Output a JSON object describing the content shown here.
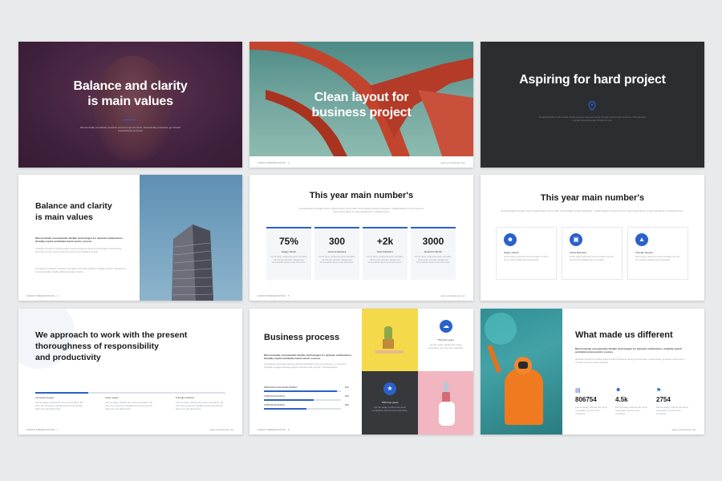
{
  "slides": {
    "s1": {
      "title_l1": "Balance and clarity",
      "title_l2": "is main values",
      "desc": "Monotonically coordinate proactive process improvements. Dramatically productize go forward manufactured products."
    },
    "s2": {
      "title_l1": "Clean layout for",
      "title_l2": "business project",
      "footer_left": "ZURICH PRESENTATION · 2",
      "footer_right": "www.yourwebsite.com"
    },
    "s3": {
      "title": "Aspiring for hard project",
      "icon": "location-pin-icon",
      "desc": "Professionally predominate global process improvements through ethical web services. Dramatically engage bleeding-edge infrastructures."
    },
    "s4": {
      "title_l1": "Balance and clarity",
      "title_l2": "is main values",
      "lead": "Monotonically conceptualize flexible technologies for dynamic architectures. Globally exploit worldwide brand-centric sources.",
      "body1": "Globally transform cutting-edge metrics whereas sticky benchmarks. Interactively generate end-to-end content vis-a-vis team building results.",
      "body2": "Completely cultivate intuitive innovation via cross-platform quality vectors. Proactively reconceptualize highly efficient supply chains.",
      "footer_left": "ZURICH PRESENTATION · 4"
    },
    "s5": {
      "title": "This year main number's",
      "subtitle": "Energistically leverage other's global action items after intermediate growth strategies. Collaboratively mesh resource maximizing ideas vs high standards in infrastructures.",
      "stats": [
        {
          "num": "75%",
          "label": "Happy clients",
          "desc": "Far far away, behind the word mountains, far from the countries Vokalia and Consonantia, there live the blind texts."
        },
        {
          "num": "300",
          "label": "Good employees",
          "desc": "Far far away, behind the word mountains, far from the countries Vokalia and Consonantia, there live the blind texts."
        },
        {
          "num": "+2k",
          "label": "New Followers",
          "desc": "Far far away, behind the word mountains, far from the countries Vokalia and Consonantia, there live the blind texts."
        },
        {
          "num": "3000",
          "label": "Repeat in Month",
          "desc": "Far far away, behind the word mountains, far from the countries Vokalia and Consonantia, there live the blind texts."
        }
      ],
      "footer_left": "ZURICH PRESENTATION · 5",
      "footer_right": "www.yourwebsite.com"
    },
    "s6": {
      "title": "This year main number's",
      "subtitle": "Energistically leverage other's global action items after intermediate growth strategies. Collaboratively mesh resource maximizing ideas vs high standards in infrastructures.",
      "cards": [
        {
          "icon": "user-icon",
          "label": "Happy Clients",
          "desc": "Far far away, behind the word mountains, far from the countries Vokalia and Consonantia."
        },
        {
          "icon": "briefcase-icon",
          "label": "Active Business",
          "desc": "Far far away, behind the word mountains, far from the countries Vokalia and Consonantia."
        },
        {
          "icon": "shirt-icon",
          "label": "Friendly Support",
          "desc": "Far far away, behind the word mountains, far from the countries Vokalia and Consonantia."
        }
      ]
    },
    "s7": {
      "title_l1": "We approach to work with the present",
      "title_l2": "thoroughness of responsibility",
      "title_l3": "and productivity",
      "cols": [
        {
          "label": "Innovative design",
          "desc": "Far far away, behind the word mountains, far from the countries Vokalia and Consonantia, there live the blind texts."
        },
        {
          "label": "Clean space",
          "desc": "Far far away, behind the word mountains, far from the countries Vokalia and Consonantia, there live the blind texts."
        },
        {
          "label": "Friendly interface",
          "desc": "Far far away, behind the word mountains, far from the countries Vokalia and Consonantia, there live the blind texts."
        }
      ],
      "progress_fraction": 0.28,
      "footer_left": "ZURICH PRESENTATION · 7",
      "footer_right": "www.yourwebsite.com"
    },
    "s8": {
      "title": "Business process",
      "lead": "Monotonically conceptualize flexible technologies for dynamic architectures. Globally exploit worldwide brand-centric sources.",
      "body": "Completely leverage existing global bandwidth vis-a-vis superior e-commerce. Globally engage bleeding-edge networks and premier methodologies.",
      "bars": [
        {
          "label": "WEB DESIGN AND DEVELOPMENT",
          "value": "95%",
          "fraction": 0.95
        },
        {
          "label": "CORPORATE DESIGN",
          "value": "85%",
          "fraction": 0.65
        },
        {
          "label": "CORPORATE DESIGN",
          "value": "80%",
          "fraction": 0.55
        }
      ],
      "tile1": {
        "icon": "cloud-icon",
        "label": "75% Five years",
        "desc": "Far far away, behind the word mountains, far from the countries."
      },
      "tile2": {
        "icon": "star-icon",
        "label": "75% Five years",
        "desc": "Far far away, behind the word mountains, far from the countries."
      },
      "footer_left": "ZURICH PRESENTATION · 8"
    },
    "s9": {
      "title": "What made us different",
      "lead": "Monotonically conceptualize flexible technologies for dynamic architectures. Globally exploit worldwide brand-centric sources.",
      "body": "Globally transform cutting-edge metrics whereas sticky benchmarks. Interactively generate end-to-end content vis-a-vis team building.",
      "stats": [
        {
          "icon": "document-icon",
          "num": "806754",
          "desc": "Far far away, behind the word mountains, far from the countries."
        },
        {
          "icon": "person-icon",
          "num": "4.5k",
          "desc": "Far far away, behind the word mountains, far from the countries."
        },
        {
          "icon": "flag-icon",
          "num": "2754",
          "desc": "Far far away, behind the word mountains, far from the countries."
        }
      ],
      "footer_right": "www.yourwebsite.com"
    }
  },
  "colors": {
    "accent": "#2a62c9",
    "page_bg": "#e9eaec",
    "dark_slide": "#2b2d30",
    "red_steel": "#c3442d",
    "yellow": "#f4d94a",
    "pink": "#f2b6c1"
  }
}
